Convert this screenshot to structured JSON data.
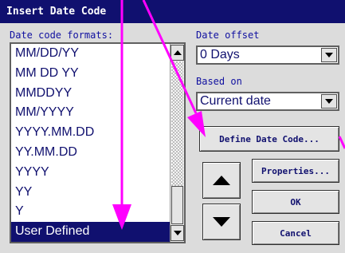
{
  "dialog": {
    "title": "Insert Date Code"
  },
  "formats": {
    "label": "Date code formats:",
    "items": [
      "MM/DD/YY",
      "MM DD YY",
      "MMDDYY",
      "MM/YYYY",
      "YYYY.MM.DD",
      "YY.MM.DD",
      "YYYY",
      "YY",
      "Y",
      "User Defined"
    ],
    "selected": "User Defined"
  },
  "offset": {
    "label": "Date offset",
    "value": "0 Days"
  },
  "based_on": {
    "label": "Based on",
    "value": "Current date"
  },
  "buttons": {
    "define": "Define Date Code...",
    "properties": "Properties...",
    "ok": "OK",
    "cancel": "Cancel"
  },
  "icons": {
    "move_up": "triangle-up-icon",
    "move_down": "triangle-down-icon",
    "dropdown": "chevron-down-icon"
  },
  "colors": {
    "title_bar": "#10106f",
    "text": "#1010a0",
    "selection": "#10106f",
    "annotation": "#ff00ff"
  }
}
